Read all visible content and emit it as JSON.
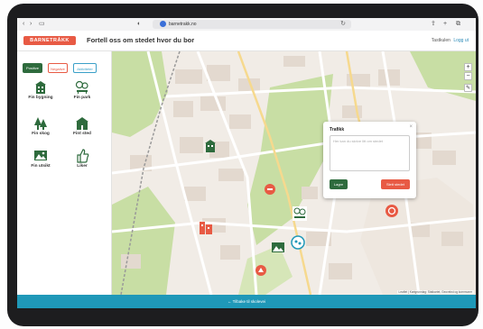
{
  "browser": {
    "url": "barnetrakk.no",
    "nav_icons": [
      "back-icon",
      "forward-icon",
      "sidebar-icon",
      "shield-icon",
      "reload-icon",
      "share-icon",
      "new-tab-icon",
      "tabs-icon"
    ]
  },
  "header": {
    "logo_text": "BARNETRÅKK",
    "title": "Fortell oss om stedet hvor du bor",
    "link_text": "Tastkulen",
    "login_text": "Logg ut"
  },
  "sidebar": {
    "filters": [
      {
        "label": "Positive"
      },
      {
        "label": "Negative"
      },
      {
        "label": "Aktiviteter"
      }
    ],
    "categories": [
      {
        "label": "Fin bygning",
        "icon": "building-icon"
      },
      {
        "label": "Fin park",
        "icon": "park-icon"
      },
      {
        "label": "Fin skog",
        "icon": "forest-icon"
      },
      {
        "label": "Fint sted",
        "icon": "place-icon"
      },
      {
        "label": "Fin utsikt",
        "icon": "view-icon"
      },
      {
        "label": "Liker",
        "icon": "thumbs-up-icon"
      }
    ]
  },
  "map": {
    "zoom_in": "+",
    "zoom_out": "−",
    "attribution": "Leaflet | Kartgrunnlag: Statkartet, Geovekst og kommuner"
  },
  "popup": {
    "title": "Trafikk",
    "close": "×",
    "placeholder": "Her kan du skrive litt om stedet",
    "save_label": "Lagre",
    "skip_label": "Slett stedet"
  },
  "footer": {
    "label": "← Tilbake til skolevei"
  },
  "colors": {
    "brand_red": "#e85a44",
    "brand_green": "#2e6b3d",
    "accent_blue": "#1f98b8",
    "park_green": "#c8dea4"
  }
}
